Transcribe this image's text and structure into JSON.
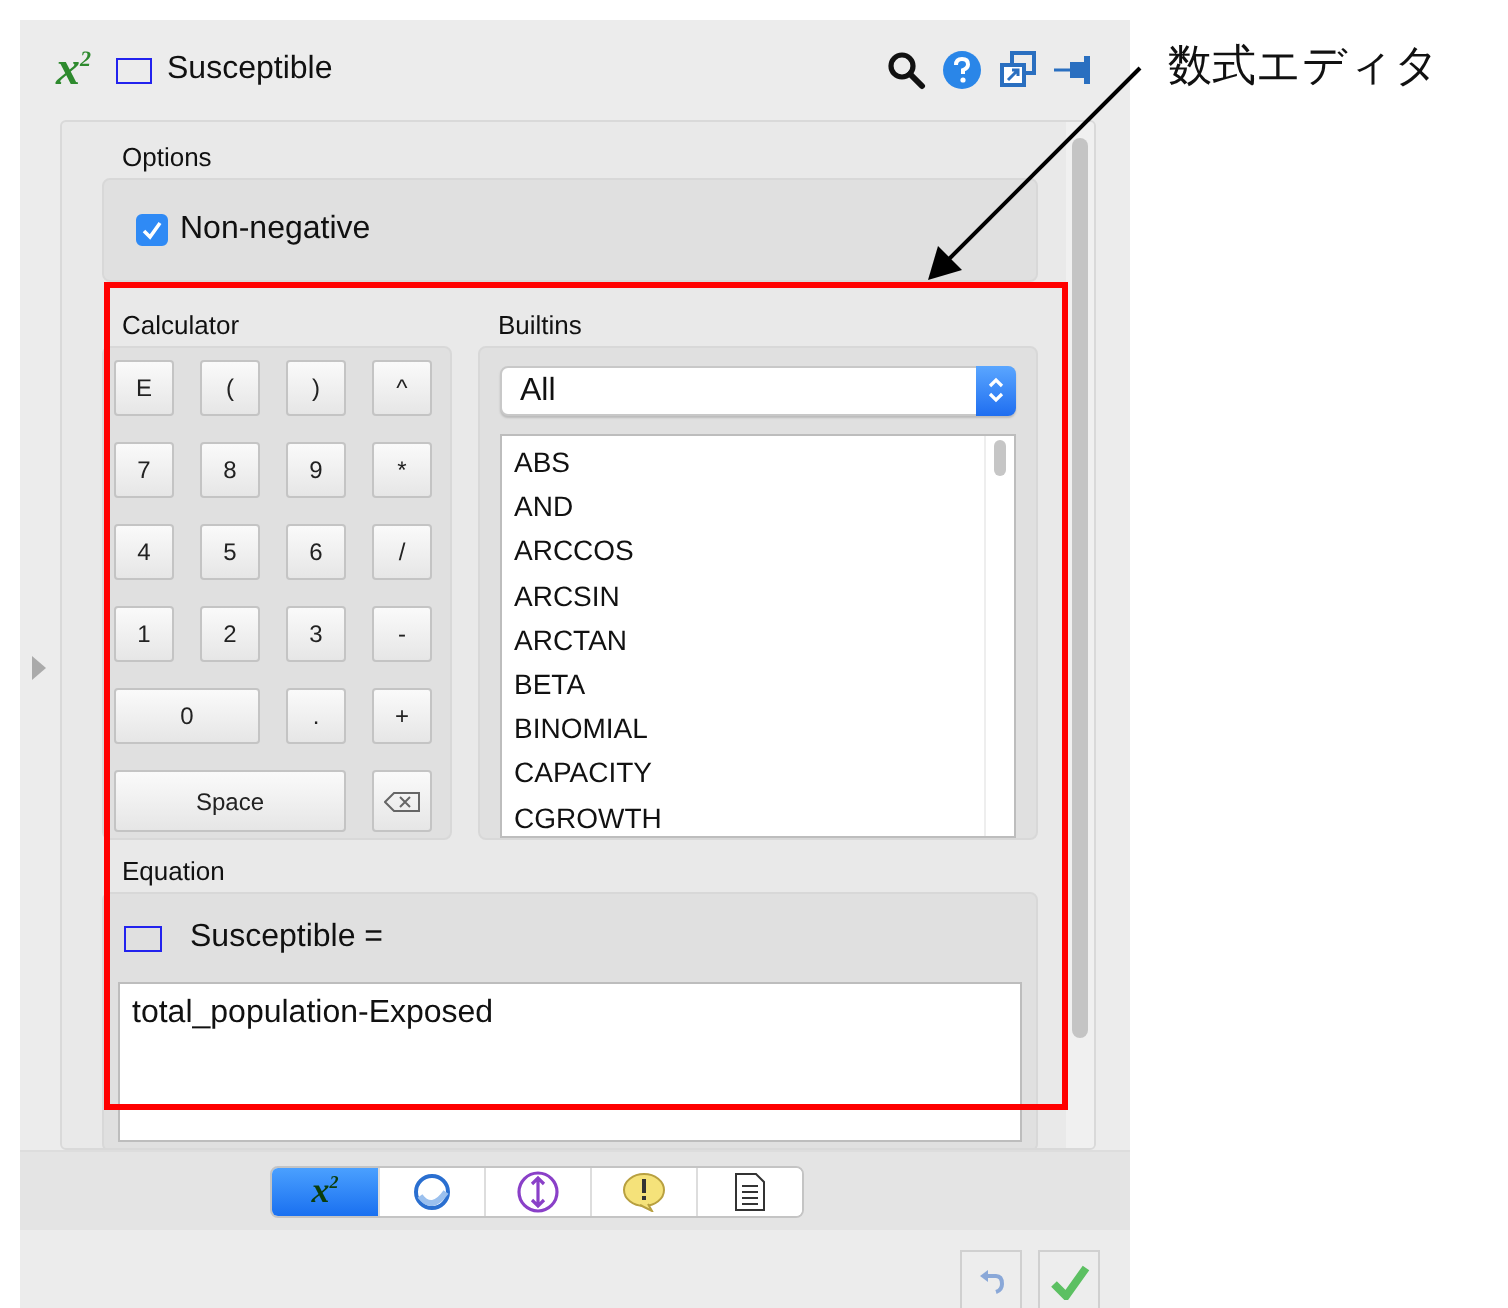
{
  "header": {
    "logo": "x$^{2}$",
    "title": "Susceptible"
  },
  "options": {
    "label": "Options",
    "non_negative": {
      "label": "Non-negative",
      "checked": true
    }
  },
  "calculator": {
    "label": "Calculator",
    "keys": [
      {
        "kind": "single",
        "label": "E"
      },
      {
        "kind": "single",
        "label": "("
      },
      {
        "kind": "single",
        "label": ")"
      },
      {
        "kind": "single",
        "label": "^"
      },
      {
        "kind": "single",
        "label": "7"
      },
      {
        "kind": "single",
        "label": "8"
      },
      {
        "kind": "single",
        "label": "9"
      },
      {
        "kind": "single",
        "label": "*"
      },
      {
        "kind": "single",
        "label": "4"
      },
      {
        "kind": "single",
        "label": "5"
      },
      {
        "kind": "single",
        "label": "6"
      },
      {
        "kind": "single",
        "label": "/"
      },
      {
        "kind": "single",
        "label": "1"
      },
      {
        "kind": "single",
        "label": "2"
      },
      {
        "kind": "single",
        "label": "3"
      },
      {
        "kind": "single",
        "label": "-"
      },
      {
        "kind": "double",
        "label": "0"
      },
      {
        "kind": "single",
        "label": "."
      },
      {
        "kind": "single",
        "label": "+"
      },
      {
        "kind": "triple",
        "label": "Space"
      },
      {
        "kind": "backspace"
      }
    ]
  },
  "builtins": {
    "label": "Builtins",
    "filter": "All",
    "items": [
      "ABS",
      "AND",
      "ARCCOS",
      "ARCSIN",
      "ARCTAN",
      "BETA",
      "BINOMIAL",
      "CAPACITY",
      "CGROWTH"
    ]
  },
  "equation": {
    "label": "Equation",
    "lhs": "Susceptible =",
    "value": "total_population-Exposed"
  },
  "tabs": [
    {
      "kind": "formula",
      "label": "x$^{2}$",
      "selected": true
    },
    {
      "kind": "circle",
      "selected": false
    },
    {
      "kind": "range",
      "selected": false
    },
    {
      "kind": "warning",
      "selected": false
    },
    {
      "kind": "document",
      "selected": false
    }
  ],
  "annotation": {
    "label": "数式エディタ"
  }
}
